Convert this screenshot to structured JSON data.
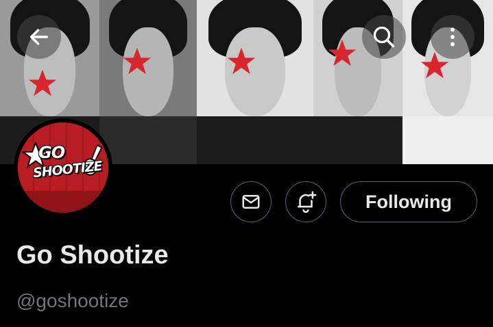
{
  "header": {
    "back_icon": "arrow-left-icon",
    "search_icon": "search-icon",
    "more_icon": "more-vertical-icon"
  },
  "avatar": {
    "logo_line1": "GO",
    "logo_line2": "SHOOTIZE"
  },
  "actions": {
    "message_icon": "mail-icon",
    "notify_icon": "bell-plus-icon",
    "follow_label": "Following"
  },
  "profile": {
    "display_name": "Go Shootize",
    "handle": "@goshootize"
  },
  "colors": {
    "accent_red": "#d7262e",
    "background": "#000000",
    "text_primary": "#e7e9ea",
    "text_secondary": "#71767b",
    "border": "#536471"
  }
}
